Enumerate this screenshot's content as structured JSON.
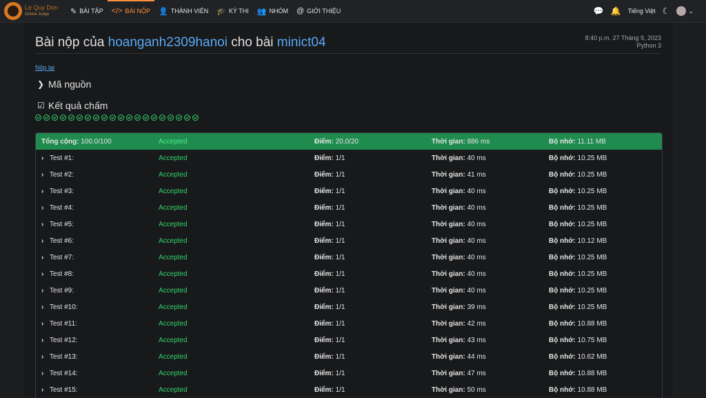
{
  "nav": {
    "logo_line1": "Le Quy Don",
    "logo_line2": "Online Judge",
    "items": [
      {
        "label": "BÀI TẬP",
        "icon": "pencil-icon",
        "glyph": "✎"
      },
      {
        "label": "BÀI NỘP",
        "icon": "code-icon",
        "glyph": "</>"
      },
      {
        "label": "THÀNH VIÊN",
        "icon": "user-icon",
        "glyph": "👤"
      },
      {
        "label": "KỲ THI",
        "icon": "graduation-cap-icon",
        "glyph": "🎓"
      },
      {
        "label": "NHÓM",
        "icon": "users-icon",
        "glyph": "👥"
      },
      {
        "label": "GIỚI THIỆU",
        "icon": "at-icon",
        "glyph": "@"
      }
    ],
    "language": "Tiếng Việt"
  },
  "page": {
    "title_prefix": "Bài nộp của",
    "user": "hoanganh2309hanoi",
    "title_mid": "cho bài",
    "problem": "minict04",
    "timestamp": "8:40 p.m. 27 Tháng 9, 2023",
    "language": "Python 3",
    "resubmit": "Nộp lại",
    "source_label": "Mã nguồn",
    "result_label": "Kết quả chấm",
    "check_count": 20
  },
  "summary": {
    "label": "Tổng cộng:",
    "score_total": "100.0/100",
    "status": "Accepted",
    "points_label": "Điểm:",
    "points": "20,0/20",
    "time_label": "Thời gian:",
    "time": "886 ms",
    "mem_label": "Bộ nhớ:",
    "memory": "11.11 MB"
  },
  "tests": [
    {
      "name": "Test #1:",
      "status": "Accepted",
      "points": "1/1",
      "time": "40 ms",
      "memory": "10.25 MB"
    },
    {
      "name": "Test #2:",
      "status": "Accepted",
      "points": "1/1",
      "time": "41 ms",
      "memory": "10.25 MB"
    },
    {
      "name": "Test #3:",
      "status": "Accepted",
      "points": "1/1",
      "time": "40 ms",
      "memory": "10.25 MB"
    },
    {
      "name": "Test #4:",
      "status": "Accepted",
      "points": "1/1",
      "time": "40 ms",
      "memory": "10.25 MB"
    },
    {
      "name": "Test #5:",
      "status": "Accepted",
      "points": "1/1",
      "time": "40 ms",
      "memory": "10.25 MB"
    },
    {
      "name": "Test #6:",
      "status": "Accepted",
      "points": "1/1",
      "time": "40 ms",
      "memory": "10.12 MB"
    },
    {
      "name": "Test #7:",
      "status": "Accepted",
      "points": "1/1",
      "time": "40 ms",
      "memory": "10.25 MB"
    },
    {
      "name": "Test #8:",
      "status": "Accepted",
      "points": "1/1",
      "time": "40 ms",
      "memory": "10.25 MB"
    },
    {
      "name": "Test #9:",
      "status": "Accepted",
      "points": "1/1",
      "time": "40 ms",
      "memory": "10.25 MB"
    },
    {
      "name": "Test #10:",
      "status": "Accepted",
      "points": "1/1",
      "time": "39 ms",
      "memory": "10.25 MB"
    },
    {
      "name": "Test #11:",
      "status": "Accepted",
      "points": "1/1",
      "time": "42 ms",
      "memory": "10.88 MB"
    },
    {
      "name": "Test #12:",
      "status": "Accepted",
      "points": "1/1",
      "time": "43 ms",
      "memory": "10.75 MB"
    },
    {
      "name": "Test #13:",
      "status": "Accepted",
      "points": "1/1",
      "time": "44 ms",
      "memory": "10.62 MB"
    },
    {
      "name": "Test #14:",
      "status": "Accepted",
      "points": "1/1",
      "time": "47 ms",
      "memory": "10.88 MB"
    },
    {
      "name": "Test #15:",
      "status": "Accepted",
      "points": "1/1",
      "time": "50 ms",
      "memory": "10.88 MB"
    }
  ],
  "colors": {
    "accent": "#ff8f3a",
    "link": "#5aa9f5",
    "accepted": "#33d36a",
    "summary_bg": "#1f8b4f"
  }
}
